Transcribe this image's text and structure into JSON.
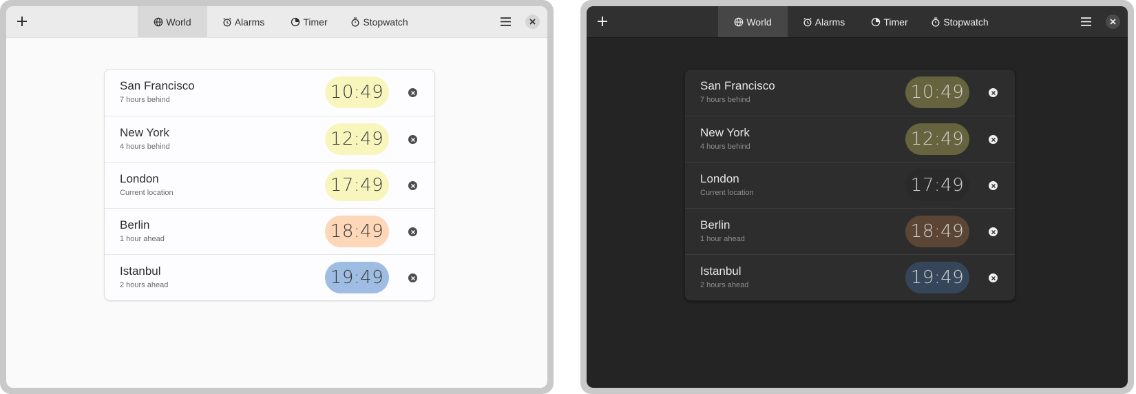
{
  "tabs": [
    "World",
    "Alarms",
    "Timer",
    "Stopwatch"
  ],
  "active_tab": "World",
  "icons": {
    "add": "plus-icon",
    "world": "globe-icon",
    "alarms": "alarm-clock-icon",
    "timer": "timer-icon",
    "stopwatch": "stopwatch-icon",
    "menu": "hamburger-menu-icon",
    "close": "close-icon",
    "remove": "remove-circle-icon"
  },
  "clocks": [
    {
      "city": "San Francisco",
      "offset": "7 hours behind",
      "time": "10:49",
      "period": "day"
    },
    {
      "city": "New York",
      "offset": "4 hours behind",
      "time": "12:49",
      "period": "day"
    },
    {
      "city": "London",
      "offset": "Current location",
      "time": "17:49",
      "period": "day"
    },
    {
      "city": "Berlin",
      "offset": "1 hour ahead",
      "time": "18:49",
      "period": "evening"
    },
    {
      "city": "Istanbul",
      "offset": "2 hours ahead",
      "time": "19:49",
      "period": "night"
    }
  ],
  "themes": {
    "light": {
      "day": "#f9f6bd",
      "evening": "#fdd7b7",
      "night": "#9fbde3",
      "neutral": "#f9f6bd"
    },
    "dark": {
      "day": "#66633f",
      "evening": "#5b4635",
      "night": "#36465a",
      "neutral": "#2a2a2a"
    }
  },
  "dark_current_location_color": "#2a2a2a"
}
